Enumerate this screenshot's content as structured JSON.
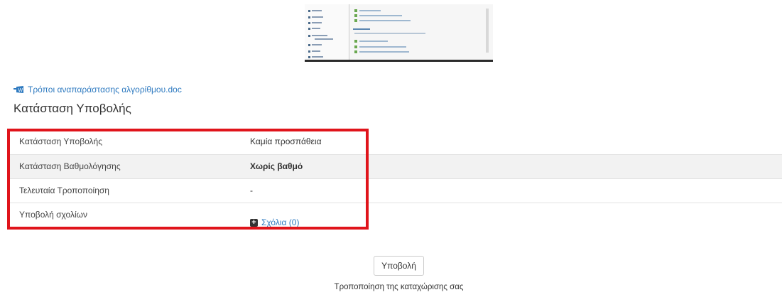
{
  "attachment": {
    "file_name": "Τρόποι αναπαράστασης αλγορίθμου.doc"
  },
  "section": {
    "title": "Κατάσταση Υποβολής"
  },
  "status_rows": [
    {
      "label": "Κατάσταση Υποβολής",
      "value": "Καμία προσπάθεια"
    },
    {
      "label": "Κατάσταση Βαθμολόγησης",
      "value": "Χωρίς βαθμό"
    },
    {
      "label": "Τελευταία Τροποποίηση",
      "value": "-"
    },
    {
      "label": "Υποβολή σχολίων",
      "value": "Σχόλια (0)"
    }
  ],
  "actions": {
    "submit_label": "Υποβολή",
    "submit_note": "Τροποποίηση της καταχώρισης σας"
  },
  "colors": {
    "link": "#2e7ac0",
    "highlight": "#e0141b",
    "shaded_row": "#f2f2f2"
  }
}
